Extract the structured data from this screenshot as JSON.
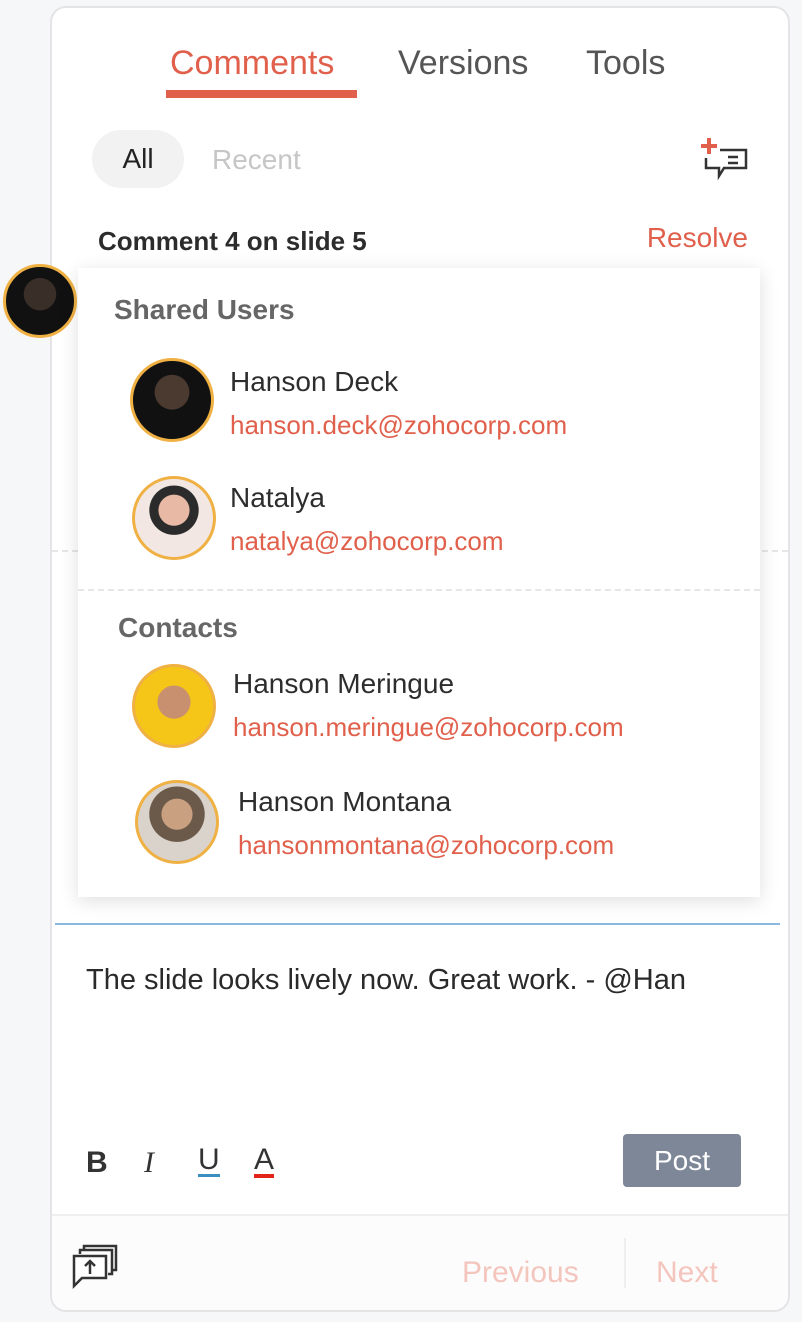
{
  "tabs": [
    {
      "label": "Comments",
      "active": true
    },
    {
      "label": "Versions"
    },
    {
      "label": "Tools"
    }
  ],
  "filters": {
    "all": "All",
    "recent": "Recent"
  },
  "icons": {
    "add_comment": "add-comment-icon",
    "export": "export-comments-icon"
  },
  "comment": {
    "title": "Comment 4 on slide 5",
    "resolve": "Resolve"
  },
  "mention": {
    "shared_users_label": "Shared Users",
    "shared_users": [
      {
        "name": "Hanson Deck",
        "email": "hanson.deck@zohocorp.com"
      },
      {
        "name": "Natalya",
        "email": "natalya@zohocorp.com"
      }
    ],
    "contacts_label": "Contacts",
    "contacts": [
      {
        "name": "Hanson Meringue",
        "email": "hanson.meringue@zohocorp.com"
      },
      {
        "name": "Hanson Montana",
        "email": "hansonmontana@zohocorp.com"
      }
    ]
  },
  "editor": {
    "text": "The slide looks lively now. Great work. - @Han",
    "bold": "B",
    "italic": "I",
    "underline": "U",
    "color": "A",
    "post": "Post"
  },
  "footer": {
    "previous": "Previous",
    "next": "Next"
  },
  "colors": {
    "accent": "#e0604c",
    "avatar_ring": "#f0b144",
    "post_bg": "#7e8798"
  }
}
